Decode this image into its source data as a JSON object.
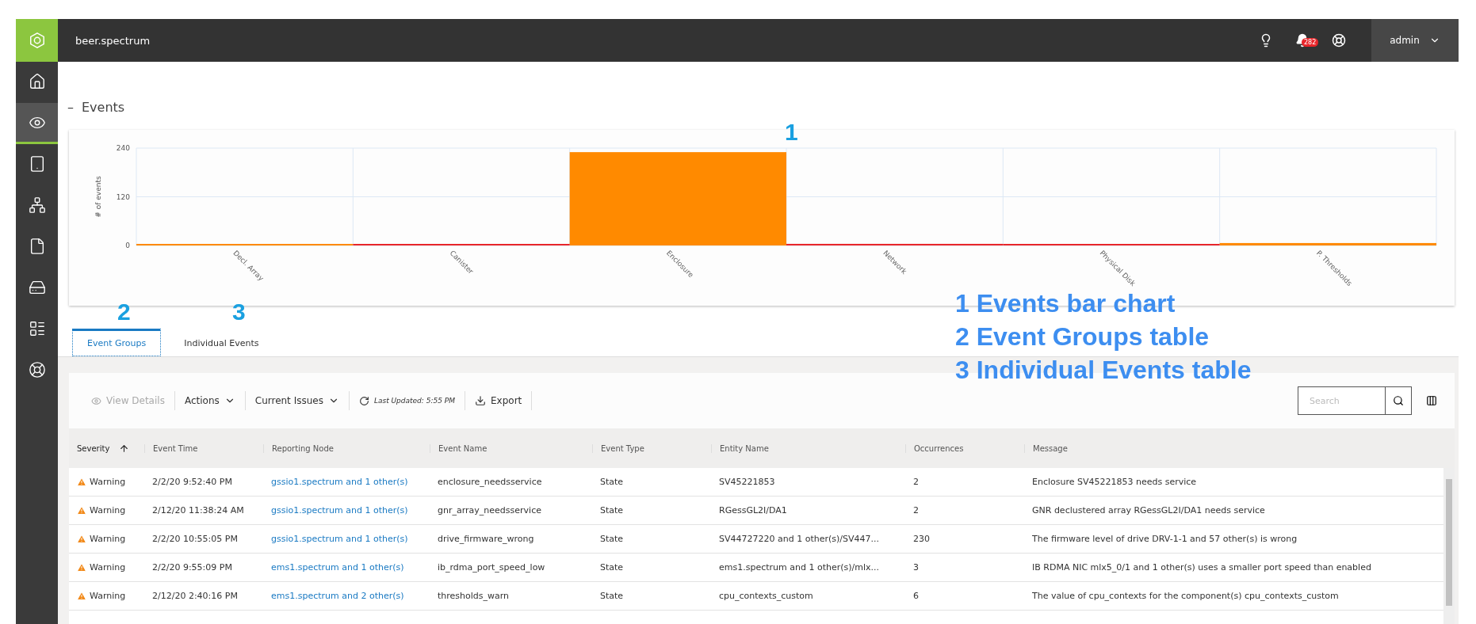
{
  "app": {
    "title": "beer.spectrum",
    "notifications": "282",
    "user": "admin"
  },
  "sidebar": {
    "items": [
      {
        "kind": "home",
        "selected": false
      },
      {
        "kind": "monitor",
        "selected": true
      },
      {
        "kind": "server",
        "selected": false
      },
      {
        "kind": "network",
        "selected": false
      },
      {
        "kind": "file",
        "selected": false
      },
      {
        "kind": "disk",
        "selected": false
      },
      {
        "kind": "rack",
        "selected": false
      },
      {
        "kind": "support",
        "selected": false
      }
    ]
  },
  "section": {
    "toggle": "–",
    "title": "Events"
  },
  "chart_data": {
    "type": "bar",
    "ylabel": "# of events",
    "categories": [
      "Decl. Array",
      "Canister",
      "Enclosure",
      "Network",
      "Physical Disk",
      "P. Thresholds"
    ],
    "stacked": true,
    "series": [
      {
        "color": "#ff8a00",
        "values": [
          1,
          null,
          230,
          null,
          null,
          6
        ]
      },
      {
        "color": "#e8262b",
        "values": [
          null,
          3,
          null,
          4,
          2,
          null
        ]
      }
    ],
    "ylim": [
      0,
      240
    ],
    "yticks": [
      0,
      120,
      240
    ]
  },
  "tabs": [
    {
      "label": "Event Groups",
      "selected": true
    },
    {
      "label": "Individual Events",
      "selected": false
    }
  ],
  "toolbar": {
    "view_details": "View Details",
    "actions": "Actions",
    "filter": "Current Issues",
    "last_updated": "Last Updated: 5:55 PM",
    "export": "Export",
    "search_placeholder": "Search"
  },
  "table": {
    "columns": [
      {
        "label": "Severity",
        "sorted": true
      },
      {
        "label": "Event Time",
        "sorted": false
      },
      {
        "label": "Reporting Node",
        "sorted": false
      },
      {
        "label": "Event Name",
        "sorted": false
      },
      {
        "label": "Event Type",
        "sorted": false
      },
      {
        "label": "Entity Name",
        "sorted": false
      },
      {
        "label": "Occurrences",
        "sorted": false
      },
      {
        "label": "Message",
        "sorted": false
      }
    ],
    "rows": [
      {
        "severity": "Warning",
        "time": "2/2/20 9:52:40 PM",
        "node": "gssio1.spectrum and 1 other(s)",
        "event": "enclosure_needsservice",
        "type": "State",
        "entity": "SV45221853",
        "occurrences": "2",
        "message": "Enclosure SV45221853 needs service"
      },
      {
        "severity": "Warning",
        "time": "2/12/20 11:38:24 AM",
        "node": "gssio1.spectrum and 1 other(s)",
        "event": "gnr_array_needsservice",
        "type": "State",
        "entity": "RGessGL2I/DA1",
        "occurrences": "2",
        "message": "GNR declustered array RGessGL2I/DA1 needs service"
      },
      {
        "severity": "Warning",
        "time": "2/2/20 10:55:05 PM",
        "node": "gssio1.spectrum and 1 other(s)",
        "event": "drive_firmware_wrong",
        "type": "State",
        "entity": "SV44727220 and 1 other(s)/SV447...",
        "occurrences": "230",
        "message": "The firmware level of drive DRV-1-1 and 57 other(s) is wrong"
      },
      {
        "severity": "Warning",
        "time": "2/2/20 9:55:09 PM",
        "node": "ems1.spectrum and 1 other(s)",
        "event": "ib_rdma_port_speed_low",
        "type": "State",
        "entity": "ems1.spectrum and 1 other(s)/mlx...",
        "occurrences": "3",
        "message": "IB RDMA NIC mlx5_0/1 and 1 other(s) uses a smaller port speed than enabled"
      },
      {
        "severity": "Warning",
        "time": "2/12/20 2:40:16 PM",
        "node": "ems1.spectrum and 2 other(s)",
        "event": "thresholds_warn",
        "type": "State",
        "entity": "cpu_contexts_custom",
        "occurrences": "6",
        "message": "The value of cpu_contexts for the component(s) cpu_contexts_custom"
      }
    ]
  },
  "callouts": [
    {
      "number": "1"
    },
    {
      "number": "2"
    },
    {
      "number": "3"
    }
  ],
  "legend": [
    "1 Events bar chart",
    "2 Event Groups table",
    "3 Individual Events table"
  ]
}
